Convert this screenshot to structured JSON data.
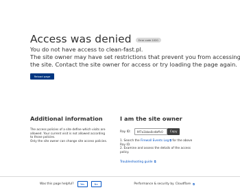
{
  "header": {
    "title": "Access was denied",
    "error_code": "Error code 1020",
    "lines": [
      "You do not have access to clean-fast.pl.",
      "The site owner may have set restrictions that prevent you from accessing",
      "the site. Contact the site owner for access or try loading the page again."
    ],
    "reload_label": "Reload page"
  },
  "additional": {
    "heading": "Additional information",
    "lines": [
      "The access policies of a site define which visits are",
      "allowed. Your current visit is not allowed according",
      "to those policies.",
      "Only the site owner can change site access policies."
    ]
  },
  "owner": {
    "heading": "I am the site owner",
    "ray_label": "Ray ID:",
    "ray_value": "9f7a1bba0cdbffc0",
    "copy_label": "Copy",
    "step1_prefix": "1. Search the ",
    "step1_link": "Firewall Events Log",
    "step1_suffix": " for the above",
    "step1_line2": "Ray ID.",
    "step2_line1": "2. Examine and assess the details of the access",
    "step2_line2": "policy.",
    "trouble_label": "Troubleshooting guide"
  },
  "footer": {
    "helpful_label": "Was this page helpful?",
    "yes_label": "Yes",
    "no_label": "No",
    "perf_label": "Performance & security by",
    "perf_link": "Cloudflare"
  },
  "icons": {
    "external_link": "external-link-icon"
  },
  "colors": {
    "primary_button": "#003681",
    "link": "#0051c3",
    "copy_button": "#404040"
  }
}
